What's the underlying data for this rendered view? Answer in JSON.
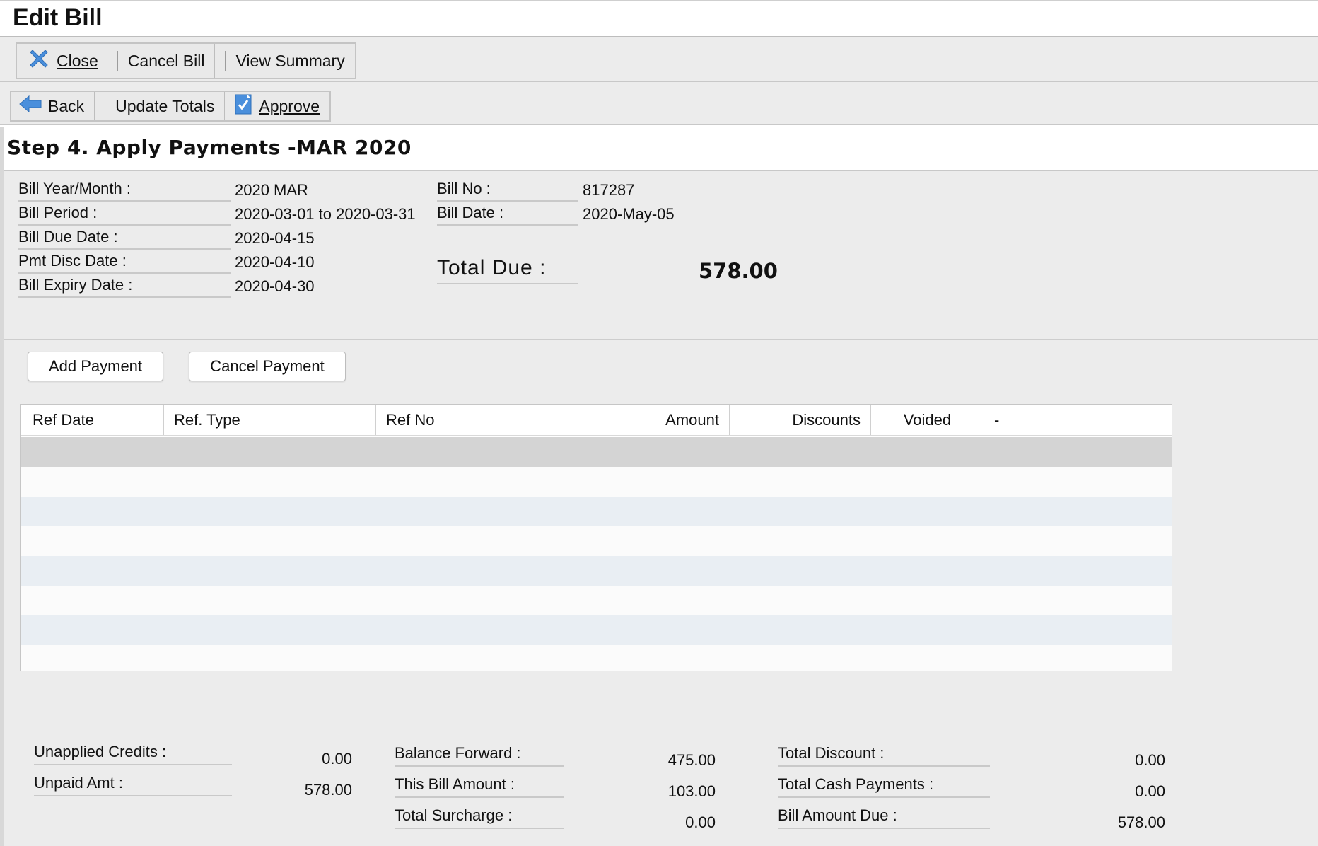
{
  "window": {
    "title": "Edit Bill"
  },
  "toolbar1": {
    "close": "Close",
    "cancel_bill": "Cancel Bill",
    "view_summary": "View Summary"
  },
  "toolbar2": {
    "back": "Back",
    "update_totals": "Update Totals",
    "approve": "Approve"
  },
  "step": {
    "title": "Step 4. Apply Payments -MAR 2020"
  },
  "bill_info": {
    "year_month": {
      "label": "Bill Year/Month :",
      "value": "2020 MAR"
    },
    "period": {
      "label": "Bill Period :",
      "value": "2020-03-01 to 2020-03-31"
    },
    "due_date": {
      "label": "Bill Due Date :",
      "value": "2020-04-15"
    },
    "pmt_disc_date": {
      "label": "Pmt Disc Date :",
      "value": "2020-04-10"
    },
    "expiry_date": {
      "label": "Bill Expiry Date :",
      "value": "2020-04-30"
    },
    "bill_no": {
      "label": "Bill No :",
      "value": "817287"
    },
    "bill_date": {
      "label": "Bill Date :",
      "value": "2020-May-05"
    },
    "total_due": {
      "label": "Total Due :",
      "value": "578.00"
    }
  },
  "payments": {
    "add_label": "Add Payment",
    "cancel_label": "Cancel Payment",
    "columns": [
      "Ref Date",
      "Ref. Type",
      "Ref No",
      "Amount",
      "Discounts",
      "Voided",
      "-"
    ],
    "rows": []
  },
  "footer": {
    "unapplied_credits": {
      "label": "Unapplied Credits :",
      "value": "0.00"
    },
    "unpaid_amt": {
      "label": "Unpaid Amt :",
      "value": "578.00"
    },
    "balance_forward": {
      "label": "Balance Forward :",
      "value": "475.00"
    },
    "this_bill_amount": {
      "label": "This Bill Amount :",
      "value": "103.00"
    },
    "total_surcharge": {
      "label": "Total Surcharge :",
      "value": "0.00"
    },
    "total_discount": {
      "label": "Total Discount :",
      "value": "0.00"
    },
    "total_cash_payments": {
      "label": "Total Cash Payments :",
      "value": "0.00"
    },
    "bill_amount_due": {
      "label": "Bill Amount Due :",
      "value": "578.00"
    }
  },
  "colors": {
    "accent_blue": "#4a8fdc",
    "selected_row": "#d4d4d4",
    "stripe_row": "#e9eef3"
  }
}
